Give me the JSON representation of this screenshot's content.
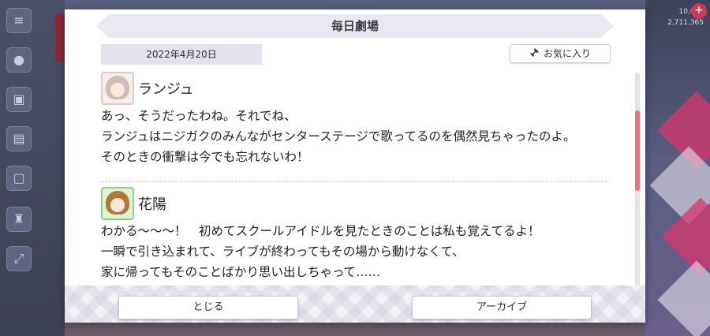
{
  "background": {
    "stats_top": "10,692",
    "stats_bottom": "2,711,365",
    "side_icons": [
      "menu-icon",
      "speech-icon",
      "bag-icon",
      "gift-icon",
      "screen-icon",
      "trophy-icon",
      "expand-icon"
    ]
  },
  "dialog": {
    "title": "毎日劇場",
    "date": "2022年4月20日",
    "favorite_label": "お気に入り",
    "entries": [
      {
        "speaker": "ランジュ",
        "lines": [
          "あっ、そうだったわね。それでね、",
          "ランジュはニジガクのみんながセンターステージで歌ってるのを偶然見ちゃったのよ。",
          "そのときの衝撃は今でも忘れないわ！"
        ]
      },
      {
        "speaker": "花陽",
        "lines": [
          "わかる～～～！　初めてスクールアイドルを見たときのことは私も覚えてるよ！",
          "一瞬で引き込まれて、ライブが終わってもその場から動けなくて、",
          "家に帰ってもそのことばかり思い出しちゃって……"
        ]
      }
    ],
    "close_label": "とじる",
    "archive_label": "アーカイブ"
  },
  "colors": {
    "accent_scroll": "#ea6f88",
    "title_bar": "#e9e9f1",
    "date_pill": "#e3e3ec"
  }
}
